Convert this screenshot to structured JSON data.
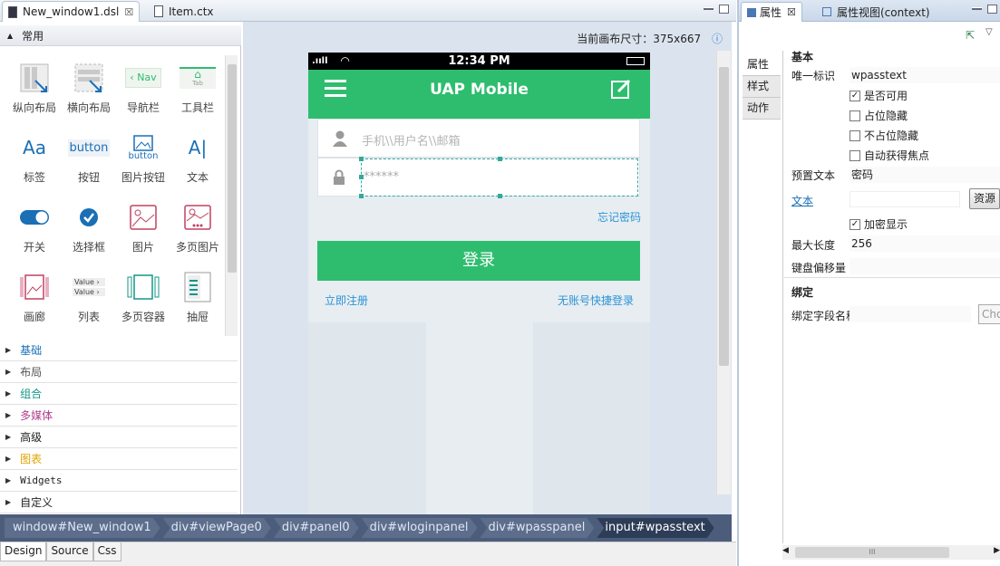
{
  "editor_tabs": [
    {
      "label": "New_window1.dsl",
      "close": "☒"
    },
    {
      "label": "Item.ctx"
    }
  ],
  "palette": {
    "header": "常用",
    "items": [
      {
        "label": "纵向布局",
        "icon": "vertical-layout-icon"
      },
      {
        "label": "横向布局",
        "icon": "horizontal-layout-icon"
      },
      {
        "label": "导航栏",
        "icon": "navbar-icon",
        "icon_text": "Nav"
      },
      {
        "label": "工具栏",
        "icon": "toolbar-icon",
        "icon_text": "Tab"
      },
      {
        "label": "标签",
        "icon": "label-icon",
        "icon_text": "Aa"
      },
      {
        "label": "按钮",
        "icon": "button-icon",
        "icon_text": "button"
      },
      {
        "label": "图片按钮",
        "icon": "image-button-icon",
        "icon_text": "button"
      },
      {
        "label": "文本",
        "icon": "text-icon",
        "icon_text": "A|"
      },
      {
        "label": "开关",
        "icon": "switch-icon"
      },
      {
        "label": "选择框",
        "icon": "checkbox-icon"
      },
      {
        "label": "图片",
        "icon": "image-icon"
      },
      {
        "label": "多页图片",
        "icon": "multipage-image-icon"
      },
      {
        "label": "画廊",
        "icon": "gallery-icon"
      },
      {
        "label": "列表",
        "icon": "list-icon",
        "icon_text_1": "Value",
        "icon_text_2": "Value"
      },
      {
        "label": "多页容器",
        "icon": "multipage-container-icon"
      },
      {
        "label": "抽屉",
        "icon": "drawer-icon"
      }
    ],
    "categories": [
      {
        "label": "基础",
        "color": "#1a6fb5"
      },
      {
        "label": "布局",
        "color": "#555555"
      },
      {
        "label": "组合",
        "color": "#14968a"
      },
      {
        "label": "多媒体",
        "color": "#b0408c"
      },
      {
        "label": "高级",
        "color": "#222222"
      },
      {
        "label": "图表",
        "color": "#e0a300"
      },
      {
        "label": "Widgets",
        "color": "#222222"
      },
      {
        "label": "自定义",
        "color": "#222222"
      }
    ]
  },
  "canvas": {
    "size_label": "当前画布尺寸：375x667",
    "info_icon": "ⓘ"
  },
  "phone": {
    "time": "12:34 PM",
    "title": "UAP Mobile",
    "username_placeholder": "手机\\\\用户名\\\\邮箱",
    "password_value": "******",
    "forgot": "忘记密码",
    "login": "登录",
    "register": "立即注册",
    "quick_login": "无账号快捷登录",
    "accent": "#2ebd6e",
    "link_color": "#2a94d6"
  },
  "breadcrumbs": [
    "window#New_window1",
    "div#viewPage0",
    "div#panel0",
    "div#wloginpanel",
    "div#wpasspanel",
    "input#wpasstext"
  ],
  "bottom_tabs": [
    "Design",
    "Source",
    "Css"
  ],
  "properties": {
    "tabs": [
      "属性",
      "属性视图(context)"
    ],
    "side_tabs": [
      "属性",
      "样式",
      "动作"
    ],
    "section_basic": "基本",
    "unique_id_label": "唯一标识",
    "unique_id_value": "wpasstext",
    "enabled": "是否可用",
    "hidden_keep": "占位隐藏",
    "hidden_nokeep": "不占位隐藏",
    "autofocus": "自动获得焦点",
    "placeholder_label": "预置文本",
    "placeholder_value": "密码",
    "text_link": "文本",
    "resource_button": "资源",
    "encrypt": "加密显示",
    "maxlen_label": "最大长度",
    "maxlen_value": "256",
    "keyboard_offset_label": "键盘偏移量",
    "section_bind": "绑定",
    "bind_field_label": "绑定字段名称",
    "choose_button": "Cho",
    "scroll_grip": "III"
  }
}
